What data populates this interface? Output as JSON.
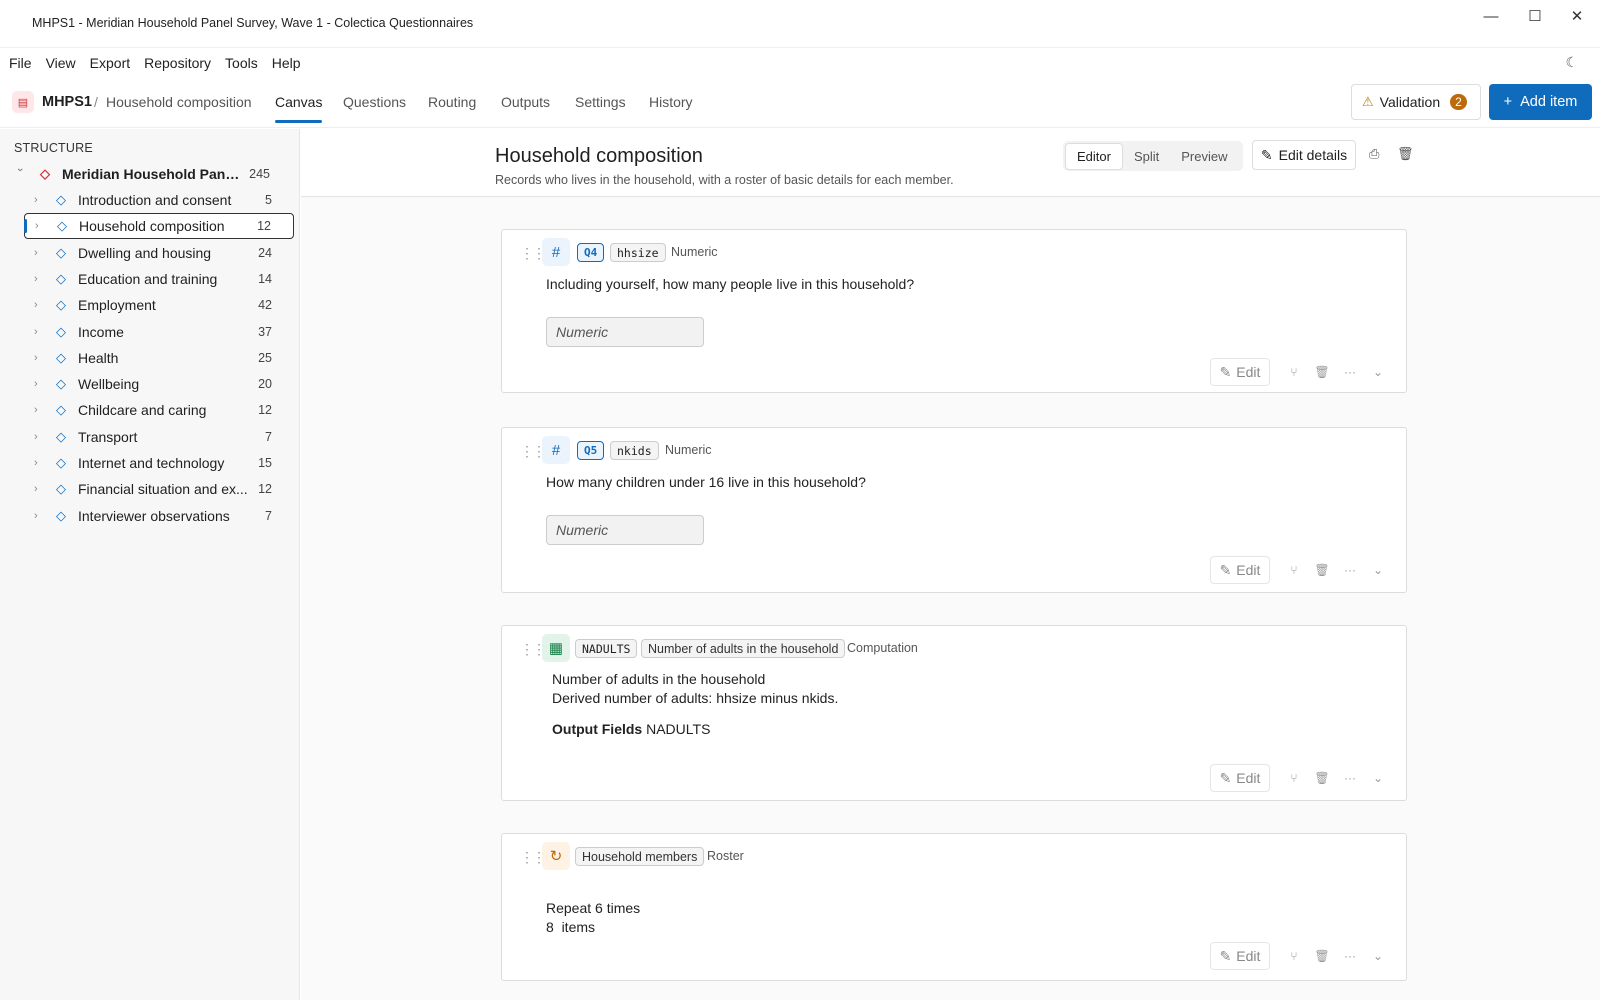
{
  "window": {
    "title": "MHPS1 - Meridian Household Panel Survey, Wave 1 - Colectica Questionnaires",
    "minimize": "—",
    "maximize": "☐",
    "close": "✕"
  },
  "menu": [
    "File",
    "View",
    "Export",
    "Repository",
    "Tools",
    "Help"
  ],
  "appbar": {
    "crumb_project": "MHPS1",
    "crumb_sep": "/",
    "crumb_section": "Household composition",
    "tabs": [
      "Canvas",
      "Questions",
      "Routing",
      "Outputs",
      "Settings",
      "History"
    ],
    "active_tab": "Canvas",
    "validation_label": "Validation",
    "validation_count": "2",
    "add_item_label": "Add item"
  },
  "sidebar": {
    "heading": "STRUCTURE",
    "root": {
      "label": "Meridian Household Pane...",
      "count": "245"
    },
    "items": [
      {
        "label": "Introduction and consent",
        "count": "5"
      },
      {
        "label": "Household composition",
        "count": "12"
      },
      {
        "label": "Dwelling and housing",
        "count": "24"
      },
      {
        "label": "Education and training",
        "count": "14"
      },
      {
        "label": "Employment",
        "count": "42"
      },
      {
        "label": "Income",
        "count": "37"
      },
      {
        "label": "Health",
        "count": "25"
      },
      {
        "label": "Wellbeing",
        "count": "20"
      },
      {
        "label": "Childcare and caring",
        "count": "12"
      },
      {
        "label": "Transport",
        "count": "7"
      },
      {
        "label": "Internet and technology",
        "count": "15"
      },
      {
        "label": "Financial situation and ex...",
        "count": "12"
      },
      {
        "label": "Interviewer observations",
        "count": "7"
      }
    ],
    "selected_index": 1
  },
  "main": {
    "title": "Household composition",
    "subtitle": "Records who lives in the household, with a roster of basic details for each member.",
    "view_modes": [
      "Editor",
      "Split",
      "Preview"
    ],
    "active_view": "Editor",
    "edit_details_label": "Edit details"
  },
  "cards": [
    {
      "qid": "Q4",
      "var": "hhsize",
      "type": "Numeric",
      "text": "Including yourself, how many people live in this household?",
      "placeholder": "Numeric",
      "edit": "Edit"
    },
    {
      "qid": "Q5",
      "var": "nkids",
      "type": "Numeric",
      "text": "How many children under 16 live in this household?",
      "placeholder": "Numeric",
      "edit": "Edit"
    },
    {
      "name": "NADULTS",
      "label": "Number of adults in the household",
      "type": "Computation",
      "line1": "Number of adults in the household",
      "line2": "Derived number of adults: hhsize minus nkids.",
      "out_label": "Output Fields",
      "out_value": "NADULTS",
      "edit": "Edit"
    },
    {
      "label": "Household members",
      "type": "Roster",
      "line1": "Repeat 6 times",
      "line2": "8  items",
      "edit": "Edit"
    }
  ]
}
